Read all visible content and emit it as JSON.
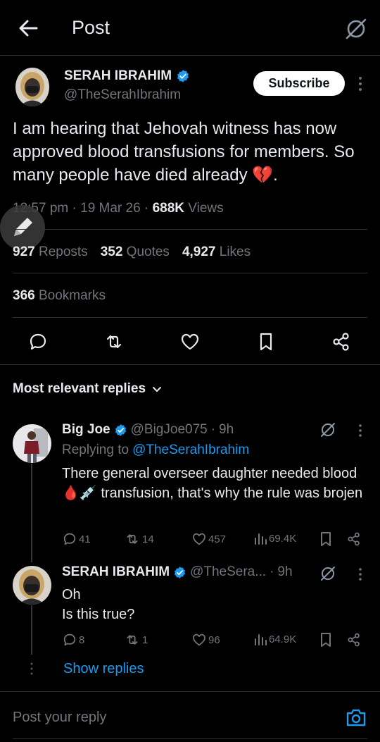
{
  "header": {
    "title": "Post"
  },
  "post": {
    "author_name": "SERAH IBRAHIM",
    "author_handle": "@TheSerahIbrahim",
    "subscribe_label": "Subscribe",
    "text": "I am hearing that Jehovah witness has now approved blood transfusions for members. So many people have died already 💔.",
    "time": "12:57 pm",
    "date": "19 Mar 26",
    "views_count": "688K",
    "views_label": "Views",
    "reposts_count": "927",
    "reposts_label": "Reposts",
    "quotes_count": "352",
    "quotes_label": "Quotes",
    "likes_count": "4,927",
    "likes_label": "Likes",
    "bookmarks_count": "366",
    "bookmarks_label": "Bookmarks"
  },
  "sort_label": "Most relevant replies",
  "replies": [
    {
      "name": "Big Joe",
      "handle": "@BigJoe075",
      "time": "9h",
      "replying_prefix": "Replying to",
      "replying_to": "@TheSerahIbrahim",
      "text": "There general overseer daughter needed blood🩸💉 transfusion, that's why the rule was brojen",
      "replies": "41",
      "reposts": "14",
      "likes": "457",
      "views": "69.4K"
    },
    {
      "name": "SERAH IBRAHIM",
      "handle": "@TheSera...",
      "time": "9h",
      "text_line1": "Oh",
      "text_line2": "Is this true?",
      "replies": "8",
      "reposts": "1",
      "likes": "96",
      "views": "64.9K"
    }
  ],
  "show_replies_label": "Show replies",
  "reply_placeholder": "Post your reply",
  "colors": {
    "accent": "#1d9bf0",
    "background": "#000000",
    "muted": "#71767b",
    "text": "#e7e9ea"
  }
}
